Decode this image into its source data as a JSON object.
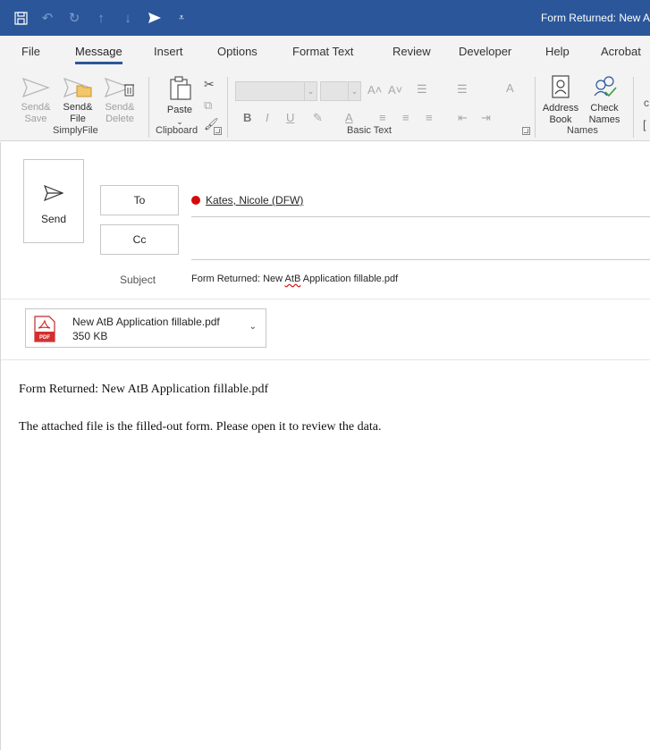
{
  "window": {
    "title": "Form Returned: New A"
  },
  "quick_access": {
    "icons": [
      "save-icon",
      "undo-icon",
      "redo-icon",
      "up-arrow-icon",
      "down-arrow-icon",
      "send-arrow-icon",
      "customize-icon"
    ]
  },
  "menu": {
    "tabs": [
      "File",
      "Message",
      "Insert",
      "Options",
      "Format Text",
      "Review",
      "Developer",
      "Help",
      "Acrobat"
    ],
    "active": "Message"
  },
  "ribbon": {
    "simplyfile": {
      "label": "SimplyFile",
      "send_save_line1": "Send&",
      "send_save_line2": "Save",
      "send_file_line1": "Send&",
      "send_file_line2": "File",
      "send_delete_line1": "Send&",
      "send_delete_line2": "Delete"
    },
    "clipboard": {
      "label": "Clipboard",
      "paste": "Paste"
    },
    "basic_text": {
      "label": "Basic Text",
      "bold": "B",
      "italic": "I",
      "underline": "U"
    },
    "names": {
      "label": "Names",
      "address_line1": "Address",
      "address_line2": "Book",
      "check_line1": "Check",
      "check_line2": "Names"
    }
  },
  "compose": {
    "send_label": "Send",
    "to_label": "To",
    "cc_label": "Cc",
    "recipient": "Kates, Nicole (DFW)",
    "presence_color": "#d40b0b",
    "subject_label": "Subject",
    "subject_before": "Form Returned: New ",
    "subject_misspelled": "AtB",
    "subject_after": " Application fillable.pdf"
  },
  "attachment": {
    "name": "New AtB Application fillable.pdf",
    "size": "350 KB",
    "icon_text": "PDF"
  },
  "body": {
    "line1": "Form Returned: New AtB Application fillable.pdf",
    "line2": "The attached file is the filled-out form. Please open it to review the data."
  },
  "colors": {
    "accent": "#2b579a",
    "ribbon_bg": "#f3f3f3"
  }
}
